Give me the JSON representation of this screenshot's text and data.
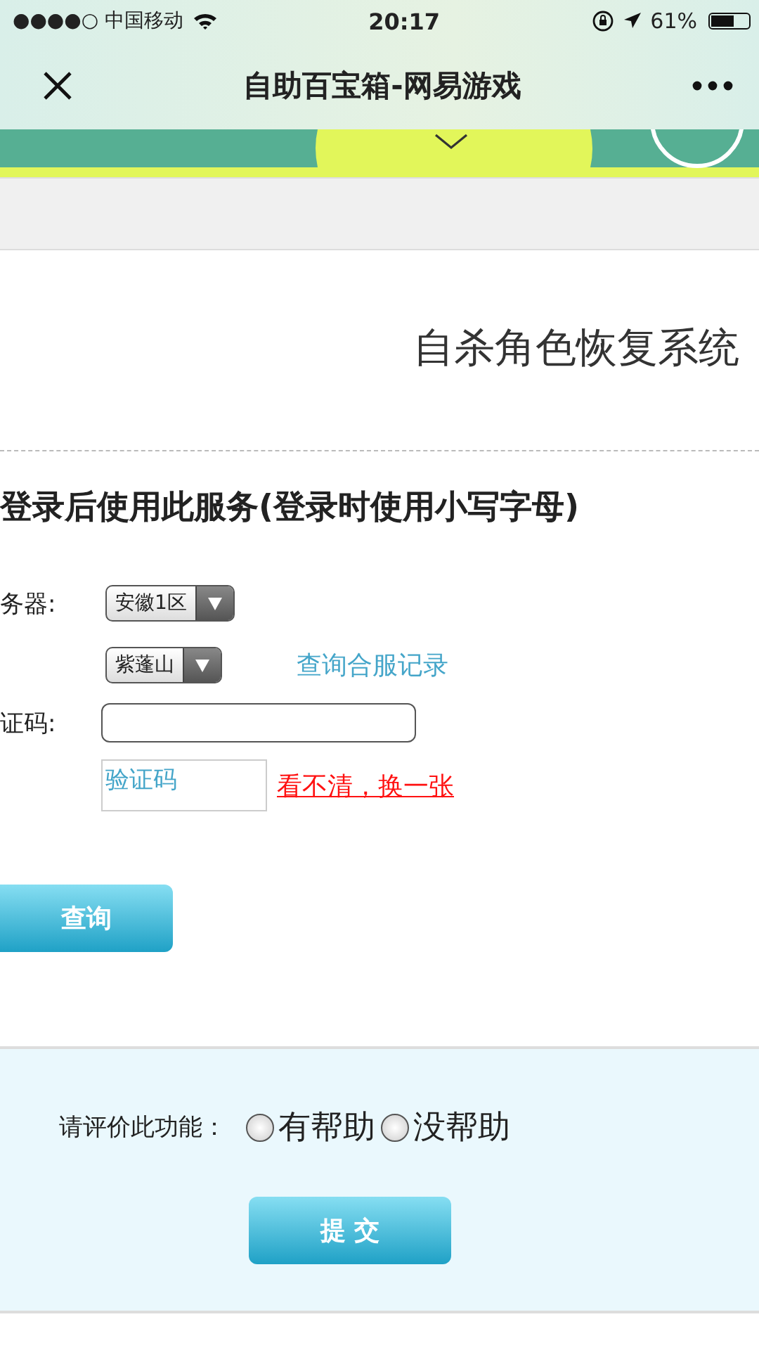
{
  "status_bar": {
    "carrier": "●●●●○ 中国移动",
    "time": "20:17",
    "battery": "61%"
  },
  "nav": {
    "title": "自助百宝箱-网易游戏"
  },
  "page": {
    "title": "自杀角色恢复系统",
    "notice": "登录后使用此服务(登录时使用小写字母)",
    "form": {
      "server_label": "务器:",
      "server_select": "安徽1区",
      "subserver_select": "紫蓬山",
      "merge_link": "查询合服记录",
      "captcha_label": "证码:",
      "captcha_image_alt": "验证码",
      "refresh_link": "看不清，换一张",
      "query_button": "查询"
    }
  },
  "rating": {
    "label": "请评价此功能：",
    "options": [
      {
        "label": "有帮助",
        "selected": false
      },
      {
        "label": "没帮助",
        "selected": false
      }
    ],
    "submit": "提 交"
  }
}
